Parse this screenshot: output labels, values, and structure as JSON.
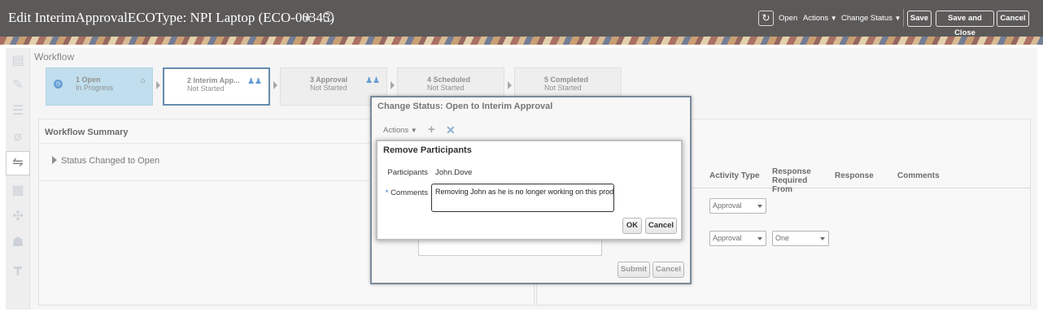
{
  "header": {
    "title": "Edit InterimApprovalECOType: NPI Laptop (ECO-00345)",
    "status_link": "Open",
    "actions_menu": "Actions",
    "change_status_menu": "Change Status",
    "save_label": "Save",
    "save_and_close_label": "Save and Close",
    "cancel_label": "Cancel"
  },
  "workflow": {
    "title": "Workflow",
    "stages": [
      {
        "label": "1 Open",
        "status": "In Progress",
        "icon": "hierarchy-icon"
      },
      {
        "label": "2 Interim App...",
        "status": "Not Started",
        "icon": "users-icon"
      },
      {
        "label": "3 Approval",
        "status": "Not Started",
        "icon": "users-icon"
      },
      {
        "label": "4 Scheduled",
        "status": "Not Started"
      },
      {
        "label": "5 Completed",
        "status": "Not Started"
      }
    ]
  },
  "summary": {
    "title": "Workflow Summary",
    "status_row": "Status Changed to Open"
  },
  "participants_table": {
    "columns": [
      "Activity Type",
      "Response Required From",
      "Response",
      "Comments"
    ],
    "rows": [
      {
        "activity_type": "Approval",
        "response_required_from": ""
      },
      {
        "activity_type": "Approval",
        "response_required_from": "One"
      }
    ]
  },
  "change_status_dialog": {
    "title": "Change Status: Open to Interim Approval",
    "actions_label": "Actions",
    "submit_label": "Submit",
    "cancel_label": "Cancel"
  },
  "remove_participants_dialog": {
    "title": "Remove Participants",
    "participants_label": "Participants",
    "participants_value": "John.Dove",
    "comments_label": "Comments",
    "comments_value": "Removing John as he is no longer working on this product.",
    "ok_label": "OK",
    "cancel_label": "Cancel"
  },
  "colors": {
    "header_bg": "#1e1b1a",
    "active_stage": "#a8d2e6",
    "current_stage_border": "#2a5f8f",
    "accent": "#2b78c5"
  }
}
